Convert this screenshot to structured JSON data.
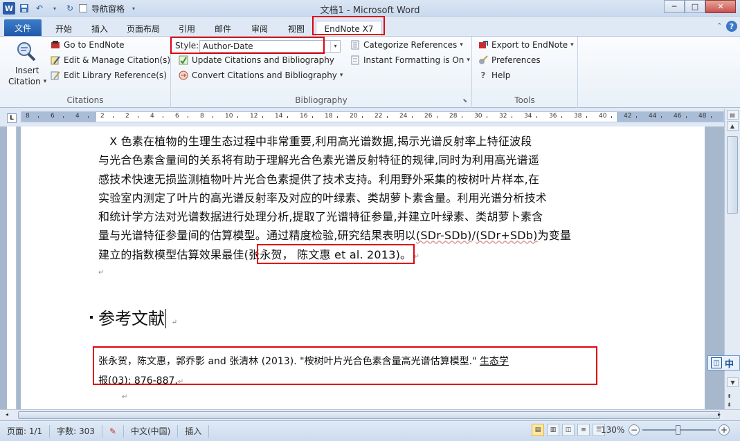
{
  "window": {
    "title": "文档1 - Microsoft Word",
    "qat_checkbox_label": "导航窗格",
    "min": "─",
    "max": "□",
    "close": "✕"
  },
  "tabs": [
    {
      "label": "文件"
    },
    {
      "label": "开始"
    },
    {
      "label": "插入"
    },
    {
      "label": "页面布局"
    },
    {
      "label": "引用"
    },
    {
      "label": "邮件"
    },
    {
      "label": "审阅"
    },
    {
      "label": "视图"
    },
    {
      "label": "EndNote X7",
      "active": true
    }
  ],
  "ribbon": {
    "citations": {
      "label": "Citations",
      "insert_citation": "Insert",
      "insert_citation_2": "Citation",
      "go_to_endnote": "Go to EndNote",
      "edit_manage": "Edit & Manage Citation(s)",
      "edit_library": "Edit Library Reference(s)"
    },
    "bibliography": {
      "label": "Bibliography",
      "style_label": "Style:",
      "style_value": "Author-Date",
      "update": "Update Citations and Bibliography",
      "convert": "Convert Citations and Bibliography",
      "categorize": "Categorize References",
      "instant": "Instant Formatting is On"
    },
    "tools": {
      "label": "Tools",
      "export": "Export to EndNote",
      "preferences": "Preferences",
      "help": "Help"
    }
  },
  "ruler": {
    "numbers": [
      "8",
      "6",
      "4",
      "2",
      "2",
      "4",
      "6",
      "8",
      "10",
      "12",
      "14",
      "16",
      "18",
      "20",
      "22",
      "24",
      "26",
      "28",
      "30",
      "32",
      "34",
      "36",
      "38",
      "40",
      "42",
      "44",
      "46",
      "48"
    ]
  },
  "document": {
    "para_lines": [
      "　X 色素在植物的生理生态过程中非常重要,利用高光谱数据,揭示光谱反射率上特征波段",
      "与光合色素含量间的关系将有助于理解光合色素光谱反射特征的规律,同时为利用高光谱遥",
      "感技术快速无损监测植物叶片光合色素提供了技术支持。利用野外采集的桉树叶片样本,在",
      "实验室内测定了叶片的高光谱反射率及对应的叶绿素、类胡萝卜素含量。利用光谱分析技术",
      "和统计学方法对光谱数据进行处理分析,提取了光谱特征参量,并建立叶绿素、类胡萝卜素含",
      "量与光谱特征参量间的估算模型。通过精度检验,研究结果表明以"
    ],
    "formula_1": "(SDr-SDb)",
    "formula_sep": "/",
    "formula_2": "(SDr+SDb)",
    "formula_tail": "为变量",
    "last_line_prefix": "建立的指数模型估算效果最佳",
    "citation": "(张永贺， 陈文惠  et al. 2013)",
    "last_line_suffix": "。",
    "heading": "参考文献",
    "reference_line1": "张永贺，陈文惠，郭乔影 and 张清林 (2013). \"桉树叶片光合色素含量高光谱估算模型.\" ",
    "reference_journal_a": "生态学",
    "reference_journal_b": "报",
    "reference_tail": "(03): 876-887."
  },
  "statusbar": {
    "page": "页面: 1/1",
    "words": "字数: 303",
    "language": "中文(中国)",
    "mode": "插入",
    "zoom": "130%",
    "zoom_level_pct": 130
  },
  "ime": {
    "label": "中"
  }
}
